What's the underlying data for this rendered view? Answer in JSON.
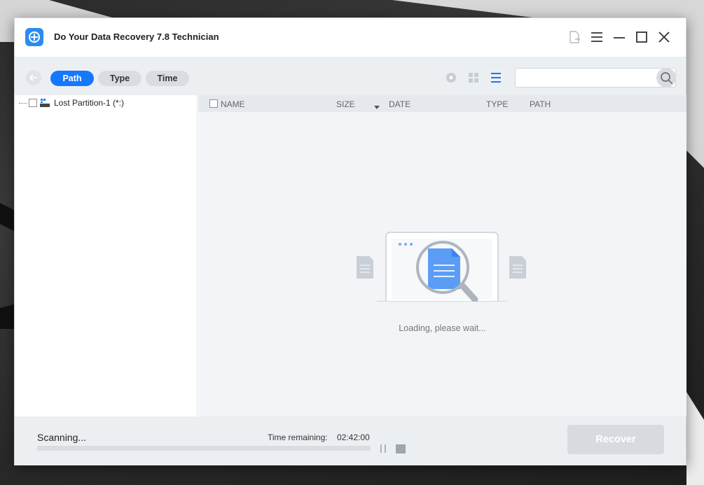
{
  "window": {
    "title": "Do Your Data Recovery 7.8 Technician"
  },
  "toolbar": {
    "tabs": [
      {
        "label": "Path",
        "active": true
      },
      {
        "label": "Type",
        "active": false
      },
      {
        "label": "Time",
        "active": false
      }
    ],
    "search_placeholder": "",
    "icons": [
      "back-arrow-icon",
      "preview-eye-icon",
      "grid-view-icon",
      "list-view-icon",
      "search-icon"
    ]
  },
  "tree": {
    "items": [
      {
        "label": "Lost Partition-1 (*:)",
        "checked": false
      }
    ]
  },
  "file_list": {
    "columns": [
      "NAME",
      "SIZE",
      "DATE",
      "TYPE",
      "PATH"
    ],
    "sort_column": "SIZE",
    "loading_text": "Loading, please wait..."
  },
  "status": {
    "scanning_text": "Scanning...",
    "time_remaining_label": "Time remaining:",
    "time_remaining_value": "02:42:00",
    "progress_fraction": 0.0
  },
  "actions": {
    "recover_label": "Recover"
  },
  "colors": {
    "accent": "#1677ff",
    "disabled_button": "#d7dbe0",
    "toolbar_bg": "#eceff2",
    "pane_bg": "#f2f4f7"
  }
}
